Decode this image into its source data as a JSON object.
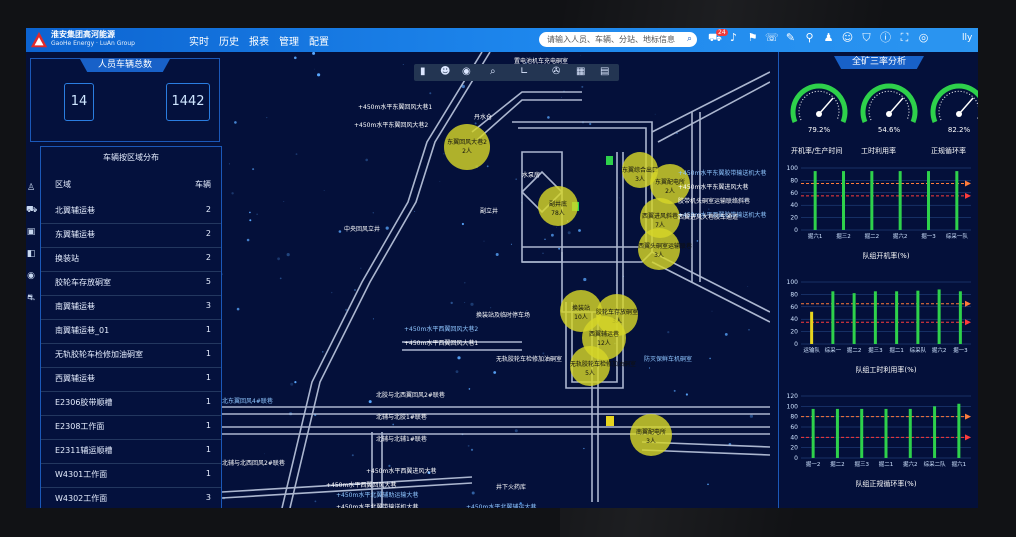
{
  "brand": {
    "name": "淮安集团高河能源",
    "en": "GaoHe Energy · LuAn Group"
  },
  "nav": [
    "实时",
    "历史",
    "报表",
    "管理",
    "配置"
  ],
  "search": {
    "placeholder": "请输入人员、车辆、分站、地标信息"
  },
  "badge": "24",
  "user": "lly",
  "icons": [
    "truck-icon",
    "bell-icon",
    "megaphone-icon",
    "phone-icon",
    "wrench-icon",
    "signal-icon",
    "person-running-icon",
    "people-icon",
    "shield-icon",
    "info-icon",
    "expand-icon",
    "user-icon"
  ],
  "left": {
    "total_title": "人员车辆总数",
    "persons": "14",
    "vehicles": "1442",
    "table_title": "车辆按区域分布",
    "col_area": "区域",
    "col_count": "车辆",
    "rows": [
      {
        "area": "北翼辅运巷",
        "count": "2"
      },
      {
        "area": "东翼辅运巷",
        "count": "2"
      },
      {
        "area": "换装站",
        "count": "2"
      },
      {
        "area": "胶轮车存放硐室",
        "count": "5"
      },
      {
        "area": "南翼辅运巷",
        "count": "3"
      },
      {
        "area": "南翼辅运巷_01",
        "count": "1"
      },
      {
        "area": "无轨胶轮车检修加油硐室",
        "count": "1"
      },
      {
        "area": "西翼辅运巷",
        "count": "1"
      },
      {
        "area": "E2306胶带顺槽",
        "count": "1"
      },
      {
        "area": "E2308工作面",
        "count": "1"
      },
      {
        "area": "E2311辅运顺槽",
        "count": "1"
      },
      {
        "area": "W4301工作面",
        "count": "1"
      },
      {
        "area": "W4302工作面",
        "count": "3"
      }
    ]
  },
  "map": {
    "bubbles": [
      {
        "name": "东翼回风大巷2",
        "count": "2人"
      },
      {
        "name": "副井底",
        "count": "78人"
      },
      {
        "name": "东翼综合出口",
        "count": "3人"
      },
      {
        "name": "东翼配电所",
        "count": "2人"
      },
      {
        "name": "西翼进风斜巷",
        "count": "7人"
      },
      {
        "name": "西翼头硐室运输联巷",
        "count": "3人"
      },
      {
        "name": "换装站",
        "count": "10人"
      },
      {
        "name": "胶轮车存放硐室",
        "count": "3人"
      },
      {
        "name": "西翼辅运巷",
        "count": "12人"
      },
      {
        "name": "无轨胶轮车检修加油硐室",
        "count": "5人"
      },
      {
        "name": "南翼配电所",
        "count": "3人"
      }
    ],
    "labels": [
      "+450m水平东翼回风大巷1",
      "+450m水平东翼回风大巷2",
      "丹水仓",
      "+450m水平东翼胶带输送机大巷",
      "+450m水平东翼进风大巷",
      "水泵房",
      "胶带机头硐室运输联络斜巷",
      "+450m水平西翼胶带输送机大巷",
      "西翼进风大巷胶车通道",
      "副立井",
      "中央回风立井",
      "+450m水平西翼回风大巷2",
      "+450m水平西翼回风大巷1",
      "无轨胶轮车检修加油硐室",
      "换装站及临时停车场",
      "防灭保鲜车机硐室",
      "北胶与北西翼回风2#联巷",
      "北辅与北胶1#联巷",
      "北辅与北辅1#联巷",
      "北东翼回风4#联巷",
      "北辅与北西回风2#联巷",
      "+450m水平西翼进风大巷",
      "+450m水平西翼回风大巷",
      "+450m水平北翼辅助运输大巷",
      "+450m水平北翼带输送机大巷",
      "井下火药库",
      "置电池机车充电硐室",
      "+450m水平北翼辅运大巷"
    ]
  },
  "right": {
    "title": "全矿三率分析",
    "gauges": [
      {
        "label": "开机率/生产时间",
        "value": "79.2%"
      },
      {
        "label": "工时利用率",
        "value": "54.6%"
      },
      {
        "label": "正规循环率",
        "value": "82.2%"
      }
    ],
    "chart_data": [
      {
        "type": "bar",
        "title": "队组开机率(%)",
        "categories": [
          "掘六1",
          "掘三2",
          "掘二2",
          "掘六2",
          "掘一3",
          "综采一队"
        ],
        "values": [
          95,
          95,
          95,
          95,
          95,
          95
        ],
        "ylim": [
          0,
          100
        ],
        "ref_lines": [
          75,
          55
        ]
      },
      {
        "type": "bar",
        "title": "队组工时利用率(%)",
        "categories": [
          "运输队",
          "综采一",
          "掘二2",
          "掘三3",
          "掘二1",
          "综采队",
          "掘六2",
          "掘一3"
        ],
        "values": [
          52,
          85,
          82,
          85,
          85,
          86,
          88,
          85
        ],
        "ylim": [
          0,
          100
        ],
        "ref_lines": [
          65,
          35
        ]
      },
      {
        "type": "bar",
        "title": "队组正规循环率(%)",
        "categories": [
          "掘一2",
          "掘二2",
          "掘三3",
          "掘二1",
          "掘六2",
          "综采二队",
          "掘六1"
        ],
        "values": [
          95,
          95,
          95,
          95,
          95,
          100,
          105
        ],
        "ylim": [
          0,
          120
        ],
        "ref_lines": [
          80,
          40
        ]
      }
    ]
  },
  "colors": {
    "topbar": "#1578e0",
    "bg": "#04103a",
    "panel_border": "#1b58b8",
    "bubble": "#d6d628",
    "bar_green": "#2ed14b",
    "bar_yellow": "#e6d41e",
    "ref_orange": "#ff7b3b",
    "ref_red": "#ff3b3b"
  }
}
